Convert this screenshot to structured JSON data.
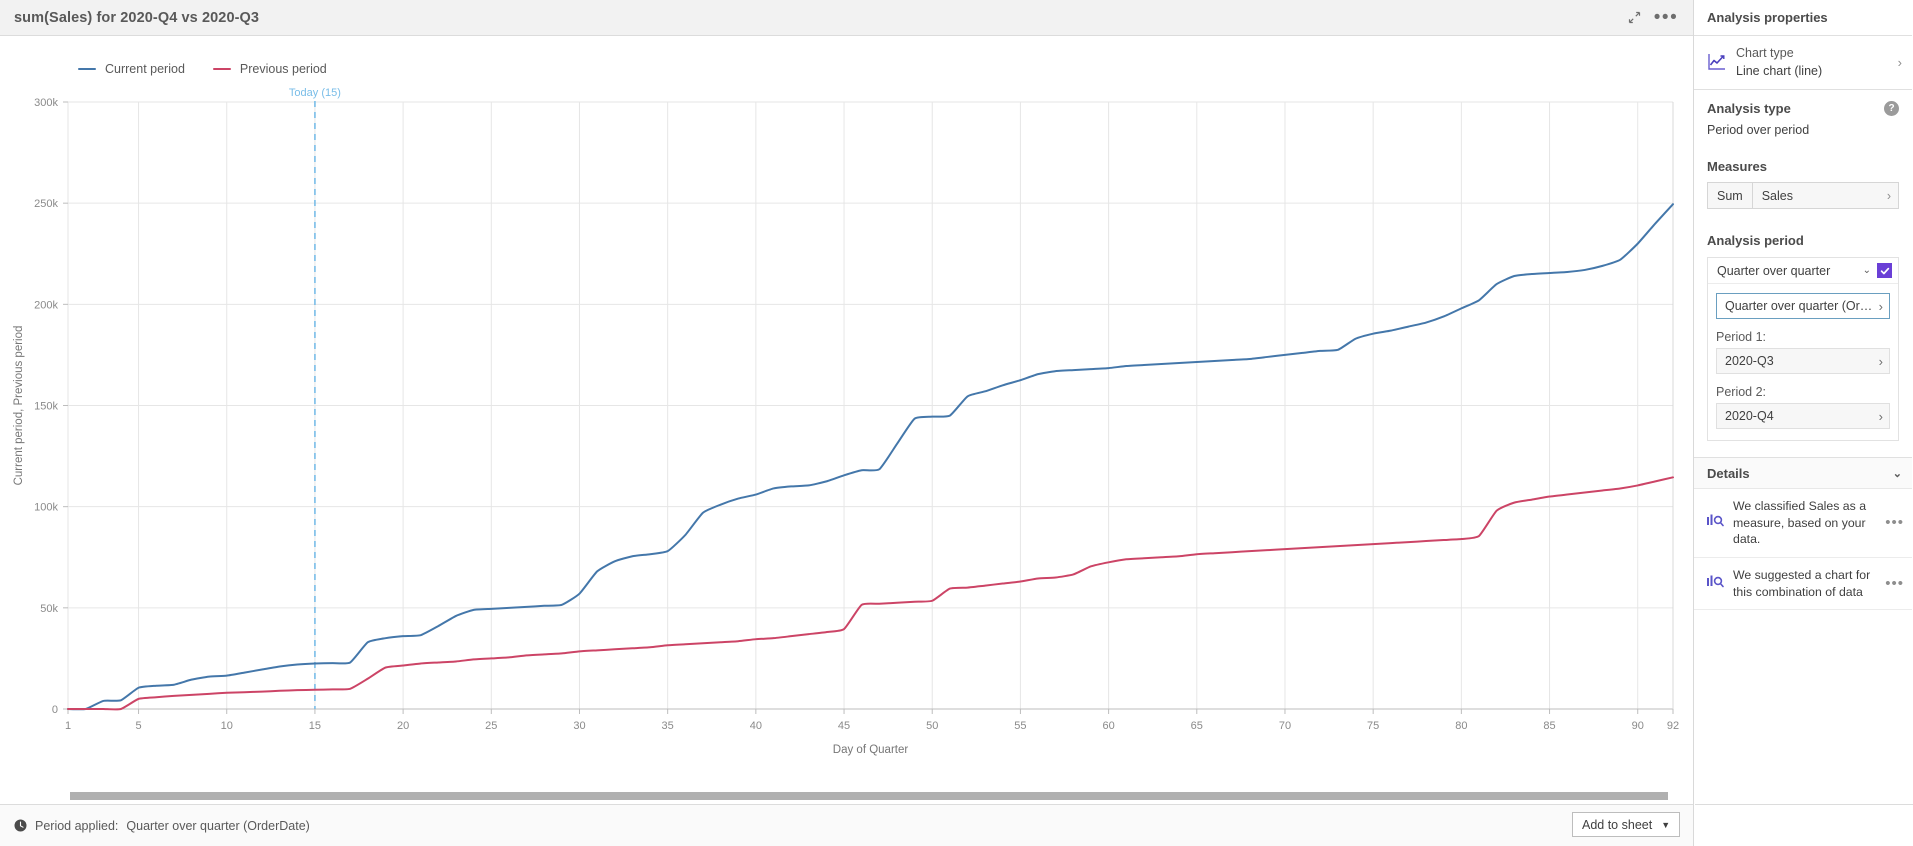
{
  "header": {
    "title": "sum(Sales) for 2020-Q4 vs 2020-Q3",
    "collapse_icon": "collapse-arrows-icon",
    "more_icon": "more-options-icon"
  },
  "legend": [
    {
      "label": "Current period",
      "color": "#4477aa"
    },
    {
      "label": "Previous period",
      "color": "#cc4466"
    }
  ],
  "statusbar": {
    "icon": "clock-icon",
    "label": "Period applied:",
    "value": "Quarter over quarter (OrderDate)"
  },
  "footer": {
    "add_to_sheet": "Add to sheet",
    "caret": "▼"
  },
  "panel": {
    "title": "Analysis properties",
    "chart_type": {
      "icon": "line-chart-icon",
      "label": "Chart type",
      "value": "Line chart (line)",
      "chevron": "›"
    },
    "analysis_type": {
      "title": "Analysis type",
      "help_icon": "help-icon",
      "value": "Period over period"
    },
    "measures": {
      "title": "Measures",
      "aggregation": "Sum",
      "field": "Sales",
      "chevron": "›"
    },
    "analysis_period": {
      "title": "Analysis period",
      "selected": "Quarter over quarter",
      "dropdown_caret": "⌄",
      "checkbox_checked": true,
      "detail_button": "Quarter over quarter (Order…",
      "period1_label": "Period 1:",
      "period1_value": "2020-Q3",
      "period2_label": "Period 2:",
      "period2_value": "2020-Q4",
      "chevron": "›"
    },
    "details": {
      "title": "Details",
      "caret": "⌄",
      "items": [
        {
          "icon": "insight-icon",
          "text": "We classified Sales as a measure, based on your data.",
          "menu": "•••"
        },
        {
          "icon": "insight-icon",
          "text": "We suggested a chart for this combination of data",
          "menu": "•••"
        }
      ]
    }
  },
  "chart_data": {
    "type": "line",
    "title": "sum(Sales) for 2020-Q4 vs 2020-Q3",
    "xlabel": "Day of Quarter",
    "ylabel": "Current period, Previous period",
    "xlim": [
      1,
      92
    ],
    "ylim": [
      0,
      300000
    ],
    "xticks": [
      1,
      5,
      10,
      15,
      20,
      25,
      30,
      35,
      40,
      45,
      50,
      55,
      60,
      65,
      70,
      75,
      80,
      85,
      90,
      92
    ],
    "xtick_labels": [
      "1",
      "5",
      "10",
      "15",
      "20",
      "25",
      "30",
      "35",
      "40",
      "45",
      "50",
      "55",
      "60",
      "65",
      "70",
      "75",
      "80",
      "85",
      "90",
      "92"
    ],
    "yticks": [
      0,
      50000,
      100000,
      150000,
      200000,
      250000,
      300000
    ],
    "ytick_labels": [
      "0",
      "50k",
      "100k",
      "150k",
      "200k",
      "250k",
      "300k"
    ],
    "grid": true,
    "legend_position": "top-left",
    "annotations": [
      {
        "type": "vline",
        "x": 15,
        "label": "Today (15)",
        "color": "#79bde8",
        "style": "dashed"
      }
    ],
    "series": [
      {
        "name": "Current period",
        "color": "#4477aa",
        "x": [
          1,
          2,
          3,
          4,
          5,
          6,
          7,
          8,
          9,
          10,
          11,
          12,
          13,
          14,
          15,
          16,
          17,
          18,
          19,
          20,
          21,
          22,
          23,
          24,
          25,
          26,
          27,
          28,
          29,
          30,
          31,
          32,
          33,
          34,
          35,
          36,
          37,
          38,
          39,
          40,
          41,
          42,
          43,
          44,
          45,
          46,
          47,
          48,
          49,
          50,
          51,
          52,
          53,
          54,
          55,
          56,
          57,
          58,
          59,
          60,
          61,
          62,
          63,
          64,
          65,
          66,
          67,
          68,
          69,
          70,
          71,
          72,
          73,
          74,
          75,
          76,
          77,
          78,
          79,
          80,
          81,
          82,
          83,
          84,
          85,
          86,
          87,
          88,
          89,
          90,
          91,
          92
        ],
        "values": [
          0,
          0,
          4000,
          4300,
          10500,
          11500,
          12000,
          14500,
          16000,
          16500,
          18000,
          19500,
          21000,
          22000,
          22500,
          22700,
          23000,
          33000,
          35000,
          36000,
          36500,
          41000,
          46000,
          49000,
          49500,
          50000,
          50500,
          51000,
          51500,
          57000,
          68000,
          73000,
          75500,
          76500,
          78000,
          86000,
          97000,
          101000,
          104000,
          106000,
          109000,
          110000,
          110500,
          112500,
          115500,
          118000,
          118500,
          131000,
          143500,
          144500,
          145000,
          154500,
          157000,
          160000,
          162500,
          165500,
          167000,
          167500,
          168000,
          168500,
          169500,
          170000,
          170500,
          171000,
          171500,
          172000,
          172500,
          173000,
          174000,
          175000,
          176000,
          177000,
          177500,
          183000,
          185500,
          187000,
          189000,
          191000,
          194000,
          198000,
          202000,
          210000,
          214000,
          215000,
          215500,
          216000,
          217000,
          219000,
          222000,
          230000,
          240000,
          249500
        ]
      },
      {
        "name": "Previous period",
        "color": "#cc4466",
        "x": [
          1,
          2,
          3,
          4,
          5,
          6,
          7,
          8,
          9,
          10,
          11,
          12,
          13,
          14,
          15,
          16,
          17,
          18,
          19,
          20,
          21,
          22,
          23,
          24,
          25,
          26,
          27,
          28,
          29,
          30,
          31,
          32,
          33,
          34,
          35,
          36,
          37,
          38,
          39,
          40,
          41,
          42,
          43,
          44,
          45,
          46,
          47,
          48,
          49,
          50,
          51,
          52,
          53,
          54,
          55,
          56,
          57,
          58,
          59,
          60,
          61,
          62,
          63,
          64,
          65,
          66,
          67,
          68,
          69,
          70,
          71,
          72,
          73,
          74,
          75,
          76,
          77,
          78,
          79,
          80,
          81,
          82,
          83,
          84,
          85,
          86,
          87,
          88,
          89,
          90,
          91,
          92
        ],
        "values": [
          0,
          0,
          0,
          0,
          5000,
          5800,
          6500,
          7000,
          7500,
          8000,
          8300,
          8600,
          9000,
          9300,
          9500,
          9700,
          10000,
          15000,
          20500,
          21500,
          22500,
          23000,
          23500,
          24500,
          25000,
          25500,
          26500,
          27000,
          27500,
          28500,
          29000,
          29500,
          30000,
          30500,
          31500,
          32000,
          32500,
          33000,
          33500,
          34500,
          35000,
          36000,
          37000,
          38000,
          39500,
          51500,
          52000,
          52500,
          53000,
          53500,
          59500,
          60000,
          61000,
          62000,
          63000,
          64500,
          65000,
          66500,
          70500,
          72500,
          74000,
          74500,
          75000,
          75500,
          76500,
          77000,
          77500,
          78000,
          78500,
          79000,
          79500,
          80000,
          80500,
          81000,
          81500,
          82000,
          82500,
          83000,
          83500,
          84000,
          85500,
          98000,
          102000,
          103500,
          105000,
          106000,
          107000,
          108000,
          109000,
          110500,
          112500,
          114500
        ]
      }
    ]
  }
}
